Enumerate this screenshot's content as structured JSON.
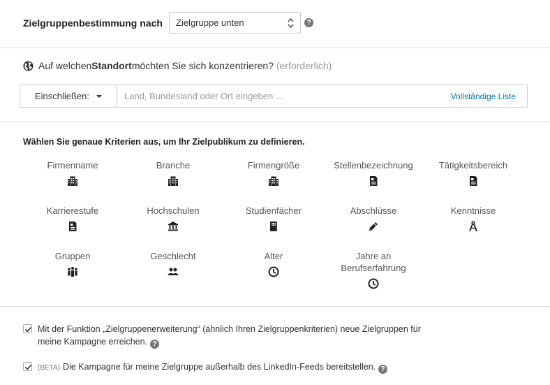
{
  "targeting": {
    "label": "Zielgruppenbestimmung nach",
    "select_value": "Zielgruppe unten",
    "help": "?"
  },
  "location": {
    "question_prefix": "Auf welchen ",
    "question_bold": "Standort",
    "question_suffix": " möchten Sie sich konzentrieren?",
    "required": "(erforderlich)",
    "include_label": "Einschließen:",
    "input_placeholder": "Land, Bundesland oder Ort eingeben …",
    "full_list_link": "Vollständige Liste"
  },
  "criteria": {
    "title": "Wählen Sie genaue Kriterien aus, um Ihr Zielpublikum zu definieren.",
    "items": [
      {
        "label": "Firmenname",
        "icon": "company-icon"
      },
      {
        "label": "Branche",
        "icon": "company-icon"
      },
      {
        "label": "Firmengröße",
        "icon": "company-icon"
      },
      {
        "label": "Stellenbezeichnung",
        "icon": "document-icon"
      },
      {
        "label": "Tätigkeitsbereich",
        "icon": "document-icon"
      },
      {
        "label": "Karrierestufe",
        "icon": "document-icon"
      },
      {
        "label": "Hochschulen",
        "icon": "university-icon"
      },
      {
        "label": "Studienfächer",
        "icon": "book-icon"
      },
      {
        "label": "Abschlüsse",
        "icon": "diploma-icon"
      },
      {
        "label": "Kenntnisse",
        "icon": "compass-icon"
      },
      {
        "label": "Gruppen",
        "icon": "group-icon"
      },
      {
        "label": "Geschlecht",
        "icon": "people-icon"
      },
      {
        "label": "Alter",
        "icon": "clock-icon"
      },
      {
        "label": "Jahre an Berufserfahrung",
        "icon": "clock-icon"
      }
    ]
  },
  "options": {
    "expansion_text": "Mit der Funktion „Zielgruppenerweiterung“ (ähnlich Ihren Zielgruppenkriterien) neue Zielgruppen für meine Kampagne erreichen.",
    "expansion_checked": true,
    "beta_tag": "(BETA)",
    "offsite_text": "Die Kampagne für meine Zielgruppe außerhalb des LinkedIn-Feeds bereitstellen.",
    "offsite_checked": true
  }
}
